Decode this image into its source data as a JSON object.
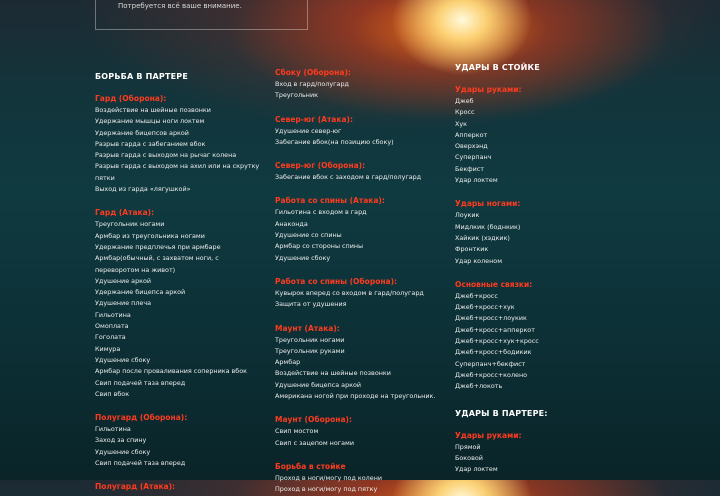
{
  "notice": "Потребуется всё ваше внимание.",
  "col1": {
    "heading": "БОРЬБА В ПАРТЕРЕ",
    "sections": [
      {
        "title": "Гард (Оборона):",
        "items": [
          "Воздействие на шейные позвонки",
          "Удержание мышцы ноги локтем",
          "Удержание бицепсов аркой",
          "Разрыв гарда с забеганием вбок",
          "Разрыв гарда с выходом на рычаг колена",
          "Разрыв гарда с выходом на ахил или на скрутку пятки",
          "Выход из гарда «лягушкой»"
        ]
      },
      {
        "title": "Гард (Атака):",
        "items": [
          "Треугольник ногами",
          "Армбар из треугольника ногами",
          "Удержание предплечья при армбаре",
          "Армбар(обычный, с захватом ноги, с переворотом на живот)",
          "Удушение аркой",
          "Удержание бицепса аркой",
          "Удушение плеча",
          "Гильотина",
          "Омоплата",
          "Гоголата",
          "Кимура",
          "Удушение сбоку",
          "Армбар после проваливания соперника вбок",
          "Свип подачей таза вперед",
          "Свип вбок"
        ]
      },
      {
        "title": "Полугард (Оборона):",
        "items": [
          "Гильотина",
          "Заход за спину",
          "Удушение сбоку",
          "Свип подачей таза вперед"
        ]
      },
      {
        "title": "Полугард (Атака):",
        "items": []
      }
    ]
  },
  "col2": {
    "sections": [
      {
        "title": "Сбоку (Оборона):",
        "items": [
          "Вход в гард/полугард",
          "Треугольник"
        ]
      },
      {
        "title": "Север-юг (Атака):",
        "items": [
          "Удушение север-юг",
          "Забегание вбок(на позицию сбоку)"
        ]
      },
      {
        "title": "Север-юг (Оборона):",
        "items": [
          "Забегание вбок с заходом в гард/полугард"
        ]
      },
      {
        "title": "Работа со спины (Атака):",
        "items": [
          "Гильотина с входом в гард",
          "Анаконда",
          "Удушение со спины",
          "Армбар со стороны спины",
          "Удушение сбоку"
        ]
      },
      {
        "title": "Работа со спины (Оборона):",
        "items": [
          "Кувырок вперед со входом в гард/полугард",
          "Защита от удушения"
        ]
      },
      {
        "title": "Маунт (Атака):",
        "items": [
          "Треугольник ногами",
          "Треугольник руками",
          "Армбар",
          "Воздействие на шейные позвонки",
          "Удушение бицепса аркой",
          "Американа ногой при проходе на треугольник."
        ]
      },
      {
        "title": "Маунт (Оборона):",
        "items": [
          "Свип мостом",
          "Свип с зацепом ногами"
        ]
      },
      {
        "title": "Борьба в стойке",
        "items": [
          "Проход в ноги/могу под колени",
          "Проход в ноги/могу под пятку"
        ]
      }
    ]
  },
  "col3": {
    "heading": "УДАРЫ В СТОЙКЕ",
    "sections": [
      {
        "title": "Удары руками:",
        "items": [
          "Джеб",
          "Кросс",
          "Хук",
          "Апперкот",
          "Оверхэнд",
          "Суперпанч",
          "Бекфист",
          "Удар локтем"
        ]
      },
      {
        "title": "Удары ногами:",
        "items": [
          "Лоукик",
          "Мидлкик (боднкик)",
          "Хайкик (хэдкик)",
          "Фронткик",
          "Удар коленом"
        ]
      },
      {
        "title": "Основные связки:",
        "items": [
          "Джеб+кросс",
          "Джеб+кросс+хук",
          "Джеб+кросс+лоукик",
          "Джеб+кросс+апперкот",
          "Джеб+кросс+хук+кросс",
          "Джеб+кросс+бодикик",
          "Суперпанч+бекфист",
          "Джеб+кросс+колено",
          "Джеб+локоть"
        ]
      }
    ],
    "heading2": "УДАРЫ В ПАРТЕРЕ:",
    "sections2": [
      {
        "title": "Удары руками:",
        "items": [
          "Прямой",
          "Боковой",
          "Удар локтем"
        ]
      }
    ]
  }
}
